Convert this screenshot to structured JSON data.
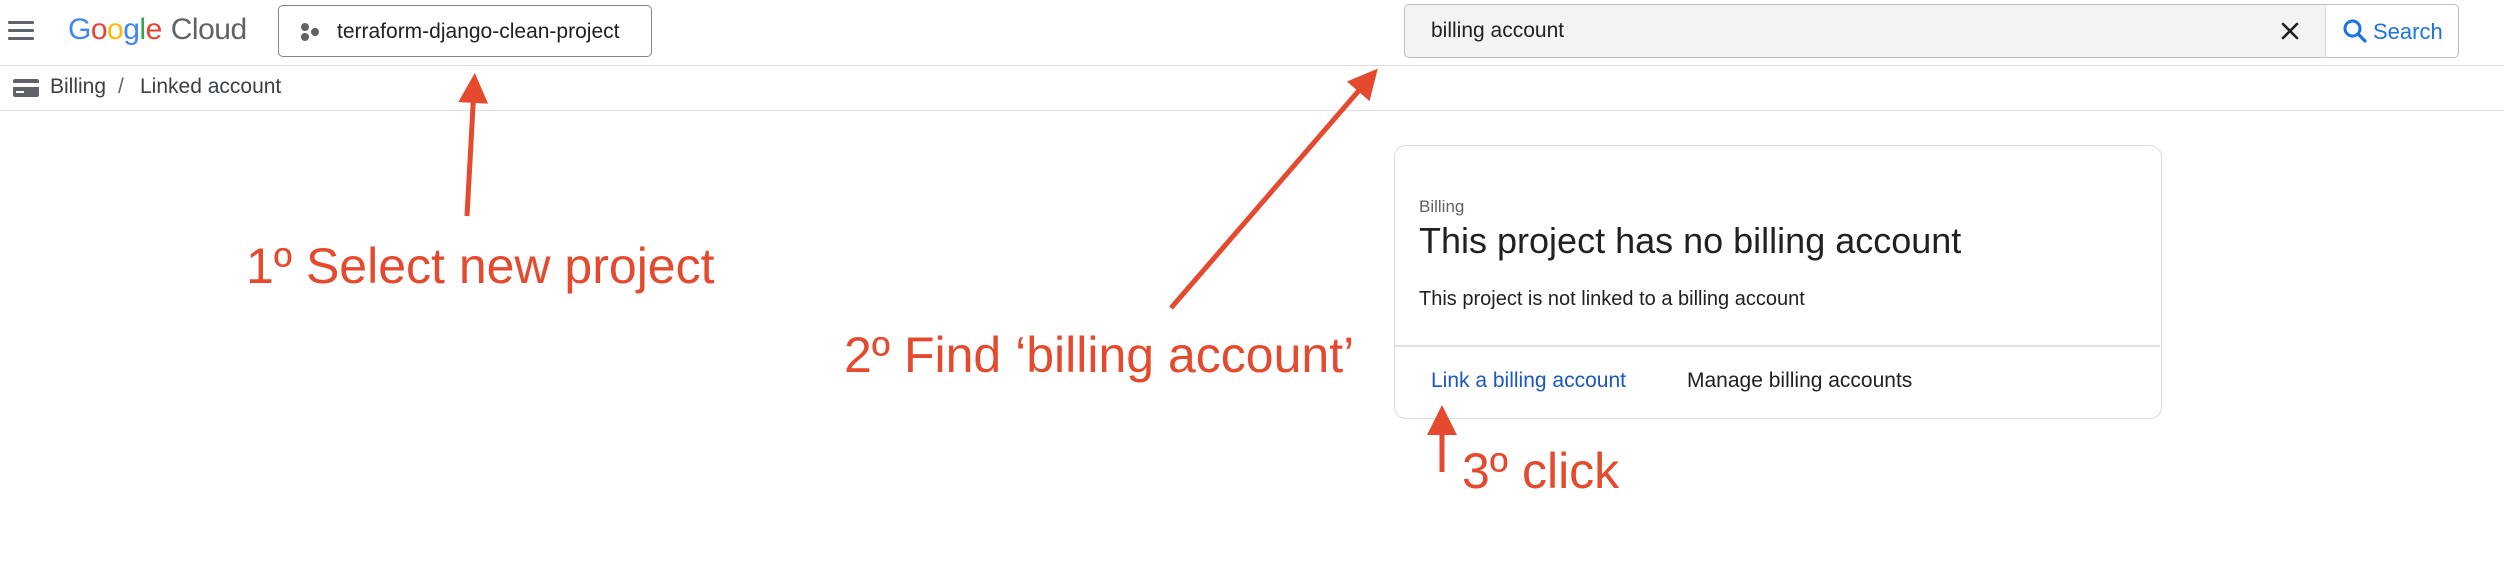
{
  "header": {
    "logo_text": "Google",
    "logo_suffix": "Cloud",
    "project_name": "terraform-django-clean-project",
    "search_value": "billing account",
    "search_button_label": "Search",
    "logo_colors": [
      "#4285F4",
      "#EA4335",
      "#FBBC05",
      "#4285F4",
      "#34A853",
      "#EA4335"
    ]
  },
  "breadcrumb": {
    "items": [
      "Billing",
      "Linked account"
    ],
    "separator": "/"
  },
  "card": {
    "eyebrow": "Billing",
    "title": "This project has no billing account",
    "body": "This project is not linked to a billing account",
    "primary_link": "Link a billing account",
    "secondary_link": "Manage billing accounts"
  },
  "annotations": {
    "step1": "1º Select new project",
    "step2": "2º Find ‘billing account’",
    "step3": "3º click",
    "color": "#E64A2E"
  },
  "colors": {
    "accent_blue": "#1A73E8",
    "link_blue": "#1A56C4",
    "border": "#DADCE0"
  }
}
